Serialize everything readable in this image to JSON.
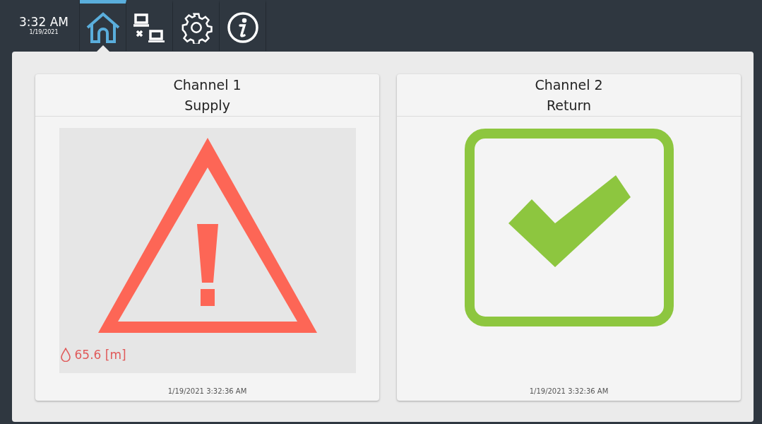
{
  "clock": {
    "time": "3:32 AM",
    "date": "1/19/2021"
  },
  "nav": [
    {
      "kind": "home",
      "selected": true
    },
    {
      "kind": "network",
      "selected": false
    },
    {
      "kind": "settings",
      "selected": false
    },
    {
      "kind": "info",
      "selected": false
    }
  ],
  "channels": [
    {
      "title": "Channel 1",
      "subtitle": "Supply",
      "kind": "alarm",
      "reading": "65.6 [m]",
      "timestamp": "1/19/2021 3:32:36 AM"
    },
    {
      "title": "Channel 2",
      "subtitle": "Return",
      "kind": "ok",
      "timestamp": "1/19/2021 3:32:36 AM"
    }
  ]
}
